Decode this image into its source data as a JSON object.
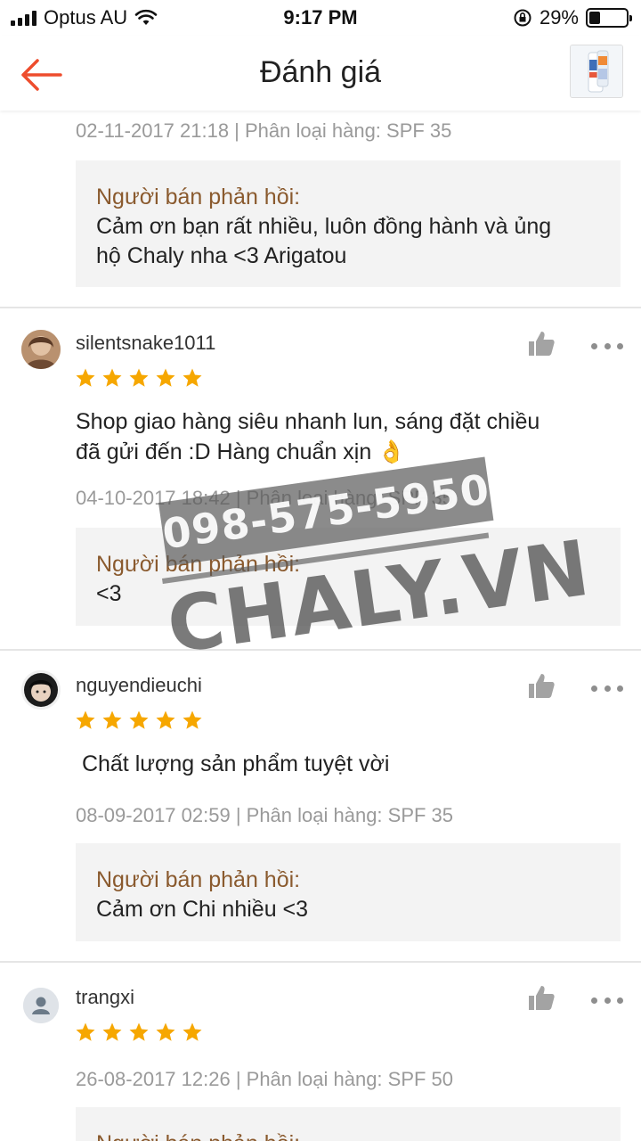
{
  "status_bar": {
    "carrier": "Optus AU",
    "time": "9:17 PM",
    "battery_percent": "29%",
    "battery_level": 0.29
  },
  "header": {
    "title": "Đánh giá",
    "back_icon": "arrow-left-icon",
    "accent_color": "#ee4d2d"
  },
  "reviews": [
    {
      "meta": "02-11-2017 21:18 | Phân loại hàng: SPF 35",
      "reply_label": "Người bán phản hồi:",
      "reply_lines": [
        "Cảm ơn bạn rất nhiều, luôn đồng hành và ủng",
        "hộ Chaly nha <3 Arigatou"
      ]
    },
    {
      "username": "silentsnake1011",
      "rating": 5,
      "comment_lines": [
        "Shop giao hàng siêu nhanh lun, sáng đặt chiều",
        "đã gửi đến :D Hàng chuẩn xịn 👌"
      ],
      "meta": "04-10-2017 18:42 | Phân loại hàng: SPF 35",
      "reply_label": "Người bán phản hồi:",
      "reply_lines": [
        "<3"
      ]
    },
    {
      "username": "nguyendieuchi",
      "rating": 5,
      "comment_lines": [
        " Chất lượng sản phẩm tuyệt vời"
      ],
      "meta": "08-09-2017 02:59 | Phân loại hàng: SPF 35",
      "reply_label": "Người bán phản hồi:",
      "reply_lines": [
        "Cảm ơn Chi nhiều <3"
      ]
    },
    {
      "username": "trangxi",
      "rating": 5,
      "meta": "26-08-2017 12:26 | Phân loại hàng: SPF 50",
      "reply_label": "Người bán phản hồi:"
    }
  ],
  "watermark": {
    "phone": "098-575-5950",
    "site": "CHALY.VN"
  },
  "colors": {
    "star": "#f6a700",
    "reply_label": "#8a5a2e",
    "meta": "#9a9a9a"
  }
}
